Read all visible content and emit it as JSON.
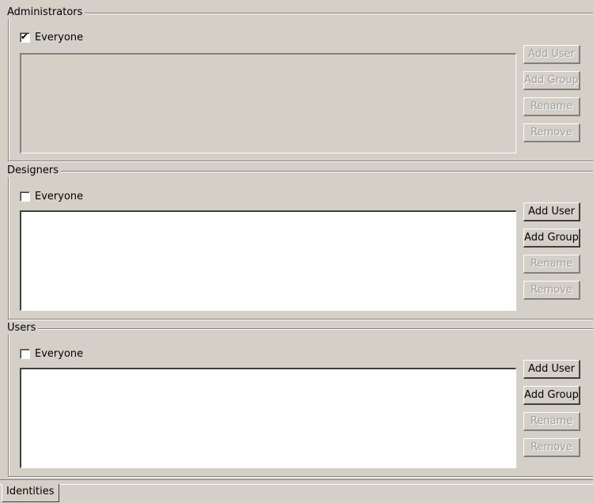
{
  "sections": [
    {
      "title": "Administrators",
      "everyone_label": "Everyone",
      "everyone_checked": true,
      "list_enabled": false,
      "buttons": [
        {
          "label": "Add User",
          "enabled": false
        },
        {
          "label": "Add Group",
          "enabled": false
        },
        {
          "label": "Rename",
          "enabled": false
        },
        {
          "label": "Remove",
          "enabled": false
        }
      ]
    },
    {
      "title": "Designers",
      "everyone_label": "Everyone",
      "everyone_checked": false,
      "list_enabled": true,
      "buttons": [
        {
          "label": "Add User",
          "enabled": true
        },
        {
          "label": "Add Group",
          "enabled": true
        },
        {
          "label": "Rename",
          "enabled": false
        },
        {
          "label": "Remove",
          "enabled": false
        }
      ]
    },
    {
      "title": "Users",
      "everyone_label": "Everyone",
      "everyone_checked": false,
      "list_enabled": true,
      "buttons": [
        {
          "label": "Add User",
          "enabled": true
        },
        {
          "label": "Add Group",
          "enabled": true
        },
        {
          "label": "Rename",
          "enabled": false
        },
        {
          "label": "Remove",
          "enabled": false
        }
      ]
    }
  ],
  "tabs": [
    {
      "label": "Identities",
      "active": true
    }
  ],
  "checkmark_glyph": "✔"
}
